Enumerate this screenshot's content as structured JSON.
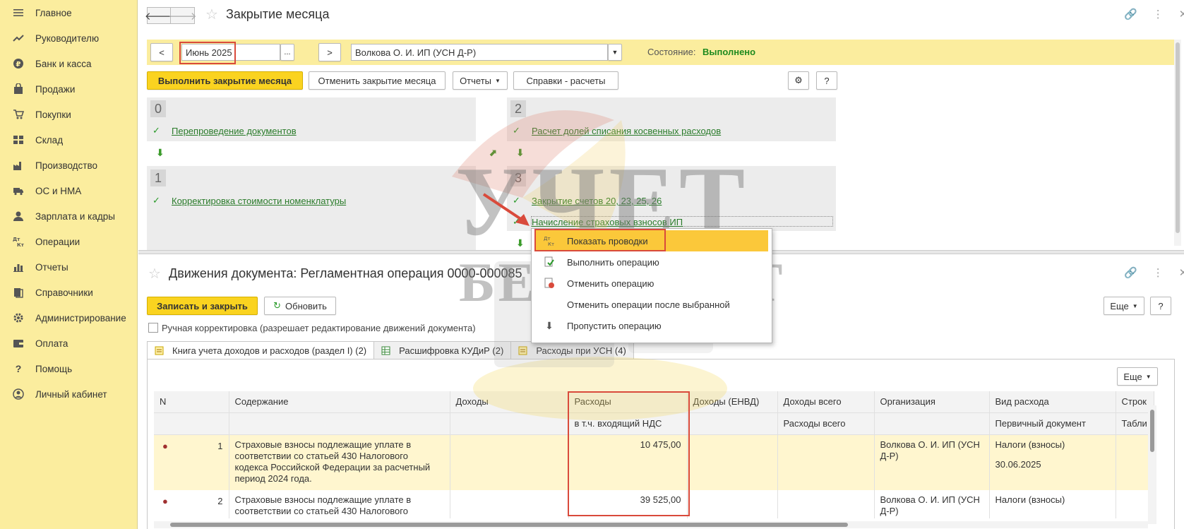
{
  "sidebar": {
    "items": [
      {
        "label": "Главное",
        "icon": "menu-icon"
      },
      {
        "label": "Руководителю",
        "icon": "trend-icon"
      },
      {
        "label": "Банк и касса",
        "icon": "ruble-icon"
      },
      {
        "label": "Продажи",
        "icon": "shopping-bag-icon"
      },
      {
        "label": "Покупки",
        "icon": "cart-icon"
      },
      {
        "label": "Склад",
        "icon": "warehouse-icon"
      },
      {
        "label": "Производство",
        "icon": "factory-icon"
      },
      {
        "label": "ОС и НМА",
        "icon": "truck-icon"
      },
      {
        "label": "Зарплата и кадры",
        "icon": "person-icon"
      },
      {
        "label": "Операции",
        "icon": "dt-kt-icon"
      },
      {
        "label": "Отчеты",
        "icon": "bar-chart-icon"
      },
      {
        "label": "Справочники",
        "icon": "books-icon"
      },
      {
        "label": "Администрирование",
        "icon": "gear-icon"
      },
      {
        "label": "Оплата",
        "icon": "wallet-icon"
      },
      {
        "label": "Помощь",
        "icon": "question-icon"
      },
      {
        "label": "Личный кабинет",
        "icon": "account-icon"
      }
    ]
  },
  "top_window": {
    "title": "Закрытие месяца",
    "period_prev": "<",
    "period": "Июнь 2025",
    "period_select": "...",
    "period_next": ">",
    "organization": "Волкова О. И. ИП (УСН Д-Р)",
    "state_label": "Состояние:",
    "state_value": "Выполнено",
    "buttons": {
      "execute": "Выполнить закрытие месяца",
      "cancel": "Отменить закрытие месяца",
      "reports": "Отчеты",
      "references": "Справки - расчеты",
      "help": "?"
    },
    "stages": [
      {
        "num": "0",
        "ops": [
          "Перепроведение документов"
        ]
      },
      {
        "num": "1",
        "ops": [
          "Корректировка стоимости номенклатуры"
        ]
      },
      {
        "num": "2",
        "ops": [
          "Расчет долей списания косвенных расходов"
        ]
      },
      {
        "num": "3",
        "ops": [
          "Закрытие счетов 20, 23, 25, 26",
          "Начисление страховых взносов ИП"
        ]
      }
    ]
  },
  "context_menu": {
    "items": [
      {
        "label": "Показать проводки",
        "icon": "dt-kt-icon"
      },
      {
        "label": "Выполнить операцию",
        "icon": "execute-doc-icon"
      },
      {
        "label": "Отменить операцию",
        "icon": "cancel-doc-icon"
      },
      {
        "label": "Отменить операции после выбранной",
        "icon": ""
      },
      {
        "label": "Пропустить операцию",
        "icon": "arrow-down-icon"
      }
    ]
  },
  "bottom_window": {
    "title": "Движения документа: Регламентная операция 0000-000085",
    "save_close": "Записать и закрыть",
    "refresh": "Обновить",
    "more": "Еще",
    "help": "?",
    "manual_correction": "Ручная корректировка (разрешает редактирование движений документа)",
    "tabs": [
      {
        "label": "Книга учета доходов и расходов (раздел I) (2)"
      },
      {
        "label": "Расшифровка КУДиР (2)"
      },
      {
        "label": "Расходы при УСН (4)"
      }
    ],
    "tab_more": "Еще",
    "table": {
      "headers": [
        "N",
        "Содержание",
        "Доходы",
        "Расходы",
        "Доходы (ЕНВД)",
        "Доходы всего",
        "Организация",
        "Вид расхода",
        "Строк"
      ],
      "subheaders": [
        "",
        "",
        "",
        "в т.ч. входящий НДС",
        "",
        "Расходы всего",
        "",
        "Первичный документ",
        "Табли"
      ],
      "rows": [
        {
          "n": "1",
          "content": "Страховые взносы подлежащие уплате в соответствии со статьей 430 Налогового кодекса Российской Федерации за расчетный период 2024 года.",
          "expense": "10 475,00",
          "org": "Волкова О. И. ИП (УСН Д-Р)",
          "kind": "Налоги (взносы)",
          "doc_date": "30.06.2025"
        },
        {
          "n": "2",
          "content": "Страховые взносы подлежащие уплате в соответствии со статьей 430 Налогового",
          "expense": "39 525,00",
          "org": "Волкова О. И. ИП (УСН Д-Р)",
          "kind": "Налоги (взносы)",
          "doc_date": ""
        }
      ]
    }
  },
  "watermark": {
    "line1": "УЧЕТ",
    "line2": "БЕЗ ЗАБОТ"
  },
  "colors": {
    "sidebar_bg": "#fbed9e",
    "accent_yellow": "#fad320",
    "link_green": "#2a7b2a",
    "highlight_red": "#d94a3b"
  }
}
